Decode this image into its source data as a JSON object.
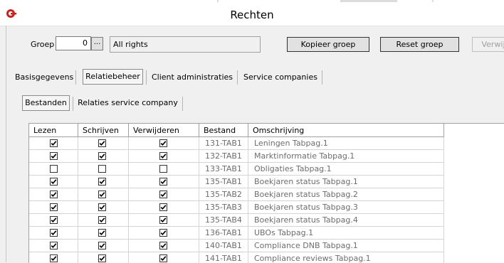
{
  "window": {
    "title": "Rechten"
  },
  "group": {
    "label": "Groep",
    "value": "0",
    "browse_label": "...",
    "name": "All rights"
  },
  "buttons": {
    "copy": "Kopieer groep",
    "reset": "Reset groep",
    "delete": "Verwij"
  },
  "tabs": [
    {
      "label": "Basisgegevens",
      "selected": false
    },
    {
      "label": "Relatiebeheer",
      "selected": true
    },
    {
      "label": "Client administraties",
      "selected": false
    },
    {
      "label": "Service companies",
      "selected": false
    }
  ],
  "subtabs": [
    {
      "label": "Bestanden",
      "selected": true
    },
    {
      "label": "Relaties service company",
      "selected": false
    }
  ],
  "grid": {
    "columns": [
      "Lezen",
      "Schrijven",
      "Verwijderen",
      "Bestand",
      "Omschrijving"
    ],
    "rows": [
      {
        "read": true,
        "write": true,
        "delete": true,
        "file": "131-TAB1",
        "desc": "Leningen Tabpag.1"
      },
      {
        "read": true,
        "write": true,
        "delete": true,
        "file": "132-TAB1",
        "desc": "Marktinformatie Tabpag.1"
      },
      {
        "read": false,
        "write": false,
        "delete": false,
        "file": "133-TAB1",
        "desc": "Obligaties Tabpag.1"
      },
      {
        "read": true,
        "write": true,
        "delete": true,
        "file": "135-TAB1",
        "desc": "Boekjaren status Tabpag.1"
      },
      {
        "read": true,
        "write": true,
        "delete": true,
        "file": "135-TAB2",
        "desc": "Boekjaren status Tabpag.2"
      },
      {
        "read": true,
        "write": true,
        "delete": true,
        "file": "135-TAB3",
        "desc": "Boekjaren status Tabpag.3"
      },
      {
        "read": true,
        "write": true,
        "delete": true,
        "file": "135-TAB4",
        "desc": "Boekjaren status Tabpag.4"
      },
      {
        "read": true,
        "write": true,
        "delete": true,
        "file": "136-TAB1",
        "desc": "UBOs Tabpag.1"
      },
      {
        "read": true,
        "write": true,
        "delete": true,
        "file": "140-TAB1",
        "desc": "Compliance DNB Tabpag.1"
      },
      {
        "read": true,
        "write": true,
        "delete": true,
        "file": "141-TAB1",
        "desc": "Compliance reviews Tabpag.1"
      }
    ]
  }
}
